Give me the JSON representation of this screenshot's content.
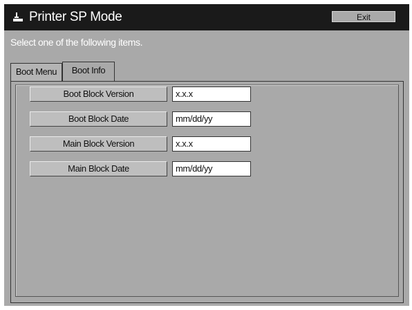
{
  "window": {
    "title": "Printer SP Mode",
    "exit_label": "Exit",
    "icon": "printer-icon"
  },
  "instruction": "Select one of the following items.",
  "tabs": [
    {
      "label": "Boot Menu",
      "active": false
    },
    {
      "label": "Boot Info",
      "active": true
    }
  ],
  "rows": [
    {
      "label": "Boot Block Version",
      "value": "x.x.x"
    },
    {
      "label": "Boot Block Date",
      "value": "mm/dd/yy"
    },
    {
      "label": "Main Block Version",
      "value": "x.x.x"
    },
    {
      "label": "Main Block Date",
      "value": "mm/dd/yy"
    }
  ],
  "colors": {
    "title_bar": "#1a1a1a",
    "panel": "#a9a9a9",
    "button": "#bebebe",
    "value_field": "#ffffff"
  }
}
